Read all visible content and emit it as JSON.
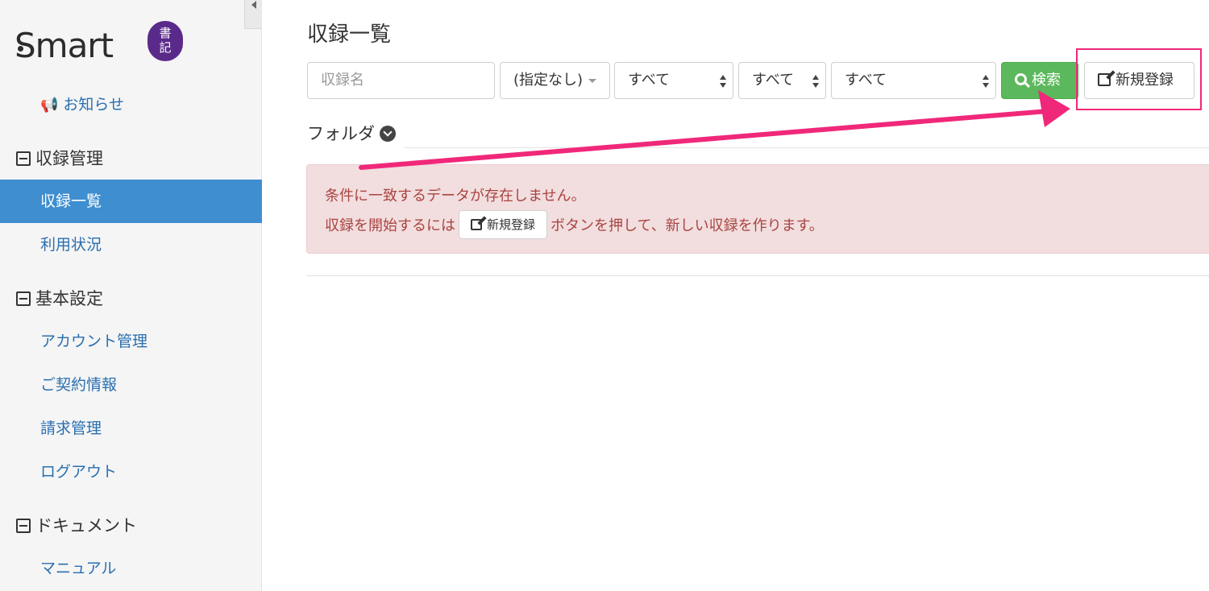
{
  "sidebar": {
    "logo": {
      "text": "Smart",
      "badge_top": "書",
      "badge_bottom": "記"
    },
    "notice_label": "お知らせ",
    "sections": [
      {
        "title": "収録管理",
        "items": [
          "収録一覧",
          "利用状況"
        ]
      },
      {
        "title": "基本設定",
        "items": [
          "アカウント管理",
          "ご契約情報",
          "請求管理",
          "ログアウト"
        ]
      },
      {
        "title": "ドキュメント",
        "items": [
          "マニュアル"
        ]
      }
    ],
    "active_item": "収録一覧"
  },
  "main": {
    "title": "収録一覧",
    "filters": {
      "search_placeholder": "収録名",
      "dropdown_value": "(指定なし)",
      "select1_value": "すべて",
      "select2_value": "すべて",
      "select3_value": "すべて"
    },
    "search_button": "検索",
    "new_button": "新規登録",
    "folder_label": "フォルダ",
    "alert": {
      "line1": "条件に一致するデータが存在しません。",
      "line2_before": "収録を開始するには",
      "inline_button": "新規登録",
      "line2_after": "ボタンを押して、新しい収録を作ります。"
    }
  },
  "colors": {
    "sidebar_active": "#3e8ed0",
    "link": "#2a6fb0",
    "search_button": "#5cb85c",
    "highlight": "#f0287a",
    "alert_bg": "#f2dede",
    "alert_text": "#a94442",
    "logo_badge": "#5a2a8a"
  }
}
